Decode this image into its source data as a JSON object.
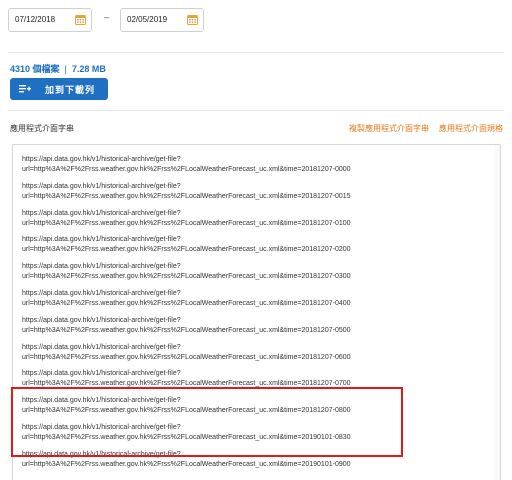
{
  "date_range": {
    "from": "07/12/2018",
    "to": "02/05/2019",
    "separator": "–"
  },
  "stats": {
    "files": "4310 個檔案",
    "size": "7.28 MB",
    "separator": "|"
  },
  "add_button": {
    "label": "加到下載列",
    "icon": "download-queue-icon"
  },
  "api_section": {
    "title": "應用程式介面字串",
    "copy_link": "複製應用程式介面字串",
    "spec_link": "應用程式介面規格"
  },
  "api_urls": [
    {
      "line1": "https://api.data.gov.hk/v1/historical-archive/get-file?",
      "line2": "url=http%3A%2F%2Frss.weather.gov.hk%2Frss%2FLocalWeatherForecast_uc.xml&time=20181207-0000"
    },
    {
      "line1": "https://api.data.gov.hk/v1/historical-archive/get-file?",
      "line2": "url=http%3A%2F%2Frss.weather.gov.hk%2Frss%2FLocalWeatherForecast_uc.xml&time=20181207-0015"
    },
    {
      "line1": "https://api.data.gov.hk/v1/historical-archive/get-file?",
      "line2": "url=http%3A%2F%2Frss.weather.gov.hk%2Frss%2FLocalWeatherForecast_uc.xml&time=20181207-0100"
    },
    {
      "line1": "https://api.data.gov.hk/v1/historical-archive/get-file?",
      "line2": "url=http%3A%2F%2Frss.weather.gov.hk%2Frss%2FLocalWeatherForecast_uc.xml&time=20181207-0200"
    },
    {
      "line1": "https://api.data.gov.hk/v1/historical-archive/get-file?",
      "line2": "url=http%3A%2F%2Frss.weather.gov.hk%2Frss%2FLocalWeatherForecast_uc.xml&time=20181207-0300"
    },
    {
      "line1": "https://api.data.gov.hk/v1/historical-archive/get-file?",
      "line2": "url=http%3A%2F%2Frss.weather.gov.hk%2Frss%2FLocalWeatherForecast_uc.xml&time=20181207-0400"
    },
    {
      "line1": "https://api.data.gov.hk/v1/historical-archive/get-file?",
      "line2": "url=http%3A%2F%2Frss.weather.gov.hk%2Frss%2FLocalWeatherForecast_uc.xml&time=20181207-0500"
    },
    {
      "line1": "https://api.data.gov.hk/v1/historical-archive/get-file?",
      "line2": "url=http%3A%2F%2Frss.weather.gov.hk%2Frss%2FLocalWeatherForecast_uc.xml&time=20181207-0600"
    },
    {
      "line1": "https://api.data.gov.hk/v1/historical-archive/get-file?",
      "line2": "url=http%3A%2F%2Frss.weather.gov.hk%2Frss%2FLocalWeatherForecast_uc.xml&time=20181207-0700"
    },
    {
      "line1": "https://api.data.gov.hk/v1/historical-archive/get-file?",
      "line2": "url=http%3A%2F%2Frss.weather.gov.hk%2Frss%2FLocalWeatherForecast_uc.xml&time=20181207-0800"
    },
    {
      "line1": "https://api.data.gov.hk/v1/historical-archive/get-file?",
      "line2": "url=http%3A%2F%2Frss.weather.gov.hk%2Frss%2FLocalWeatherForecast_uc.xml&time=20190101-0830"
    },
    {
      "line1": "https://api.data.gov.hk/v1/historical-archive/get-file?",
      "line2": "url=http%3A%2F%2Frss.weather.gov.hk%2Frss%2FLocalWeatherForecast_uc.xml&time=20190101-0900"
    }
  ],
  "colors": {
    "accent_blue": "#1f6fc3",
    "link_orange": "#e37a1b",
    "highlight_red": "#e01a1a",
    "calendar_icon": "#e8a33d"
  },
  "icons": {
    "calendar": "calendar-icon"
  }
}
